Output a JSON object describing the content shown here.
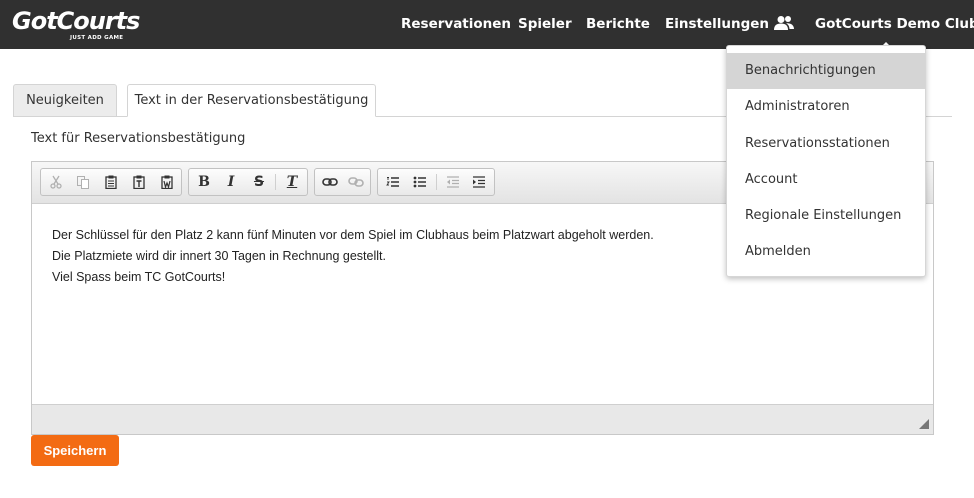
{
  "header": {
    "logo_text": "GotCourts",
    "logo_tagline": "JUST ADD GAME",
    "nav": {
      "reservations": "Reservationen",
      "players": "Spieler",
      "reports": "Berichte",
      "settings": "Einstellungen",
      "club": "GotCourts Demo Club"
    },
    "users_icon": "users-icon"
  },
  "tabs": {
    "news": "Neuigkeiten",
    "confirmation_text": "Text in der Reservationsbestätigung"
  },
  "form": {
    "field_label": "Text für Reservationsbestätigung",
    "editor_lines": [
      "Der Schlüssel für den Platz 2 kann fünf Minuten vor dem Spiel im Clubhaus beim Platzwart abgeholt werden.",
      "Die Platzmiete wird dir innert 30 Tagen in Rechnung gestellt.",
      "Viel Spass beim TC GotCourts!"
    ],
    "save_label": "Speichern"
  },
  "toolbar": {
    "icons": [
      "cut-icon",
      "copy-icon",
      "paste-icon",
      "paste-text-icon",
      "paste-word-icon",
      "bold-icon",
      "italic-icon",
      "strikethrough-icon",
      "remove-format-icon",
      "link-icon",
      "unlink-icon",
      "numbered-list-icon",
      "bulleted-list-icon",
      "outdent-icon",
      "indent-icon"
    ],
    "bold": "B",
    "italic": "I",
    "strike": "S",
    "clear": "T"
  },
  "dropdown": {
    "items": [
      "Benachrichtigungen",
      "Administratoren",
      "Reservationsstationen",
      "Account",
      "Regionale Einstellungen",
      "Abmelden"
    ],
    "active_index": 0
  },
  "colors": {
    "topbar": "#303030",
    "accent": "#f36b13"
  }
}
